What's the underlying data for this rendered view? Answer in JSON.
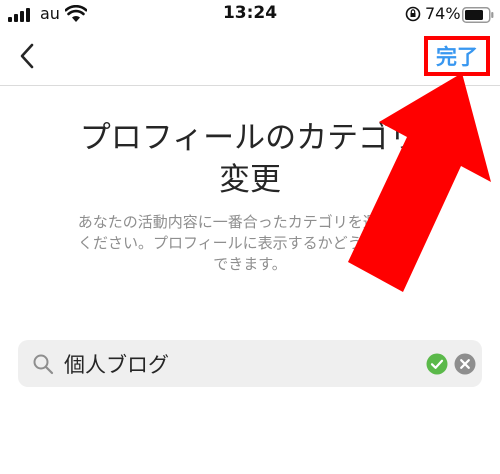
{
  "status_bar": {
    "carrier": "au",
    "time": "13:24",
    "battery_percent": "74%"
  },
  "nav": {
    "back_icon": "chevron-left-icon",
    "done_label": "完了"
  },
  "title": {
    "line1": "プロフィールのカテゴリ",
    "line2": "変更"
  },
  "description": {
    "line1": "あなたの活動内容に一番合ったカテゴリを選択して",
    "line2": "ください。プロフィールに表示するかどうかは選択",
    "line3": "できます。"
  },
  "search": {
    "value": "個人ブログ",
    "icons": [
      "search-icon",
      "check-circle-icon",
      "clear-icon"
    ]
  },
  "colors": {
    "accent": "#3897f0",
    "annotation": "#ff0000",
    "check": "#5bb94a",
    "muted": "#8e8e8e"
  }
}
